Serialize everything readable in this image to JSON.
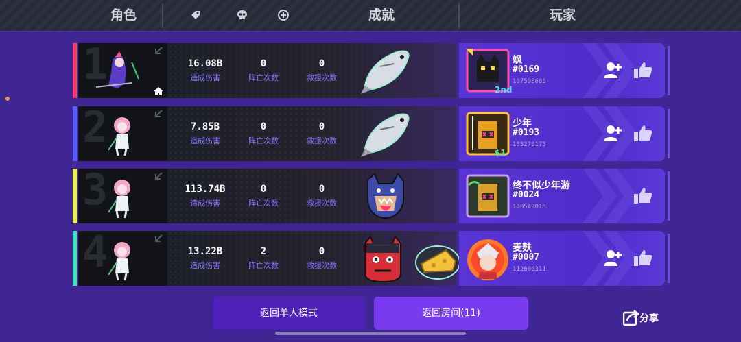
{
  "header": {
    "role_label": "角色",
    "achievement_label": "成就",
    "player_label": "玩家"
  },
  "stat_labels": {
    "damage": "造成伤害",
    "deaths": "阵亡次数",
    "rescues": "救援次数"
  },
  "rows": [
    {
      "rank": "1",
      "stripe_color": "#ff3d6e",
      "damage": "16.08B",
      "deaths": "0",
      "rescues": "0",
      "player": {
        "name": "飒",
        "tag": "#0169",
        "id": "107598686"
      }
    },
    {
      "rank": "2",
      "stripe_color": "#5a5cff",
      "damage": "7.85B",
      "deaths": "0",
      "rescues": "0",
      "player": {
        "name": "少年",
        "tag": "#0193",
        "id": "103270173"
      }
    },
    {
      "rank": "3",
      "stripe_color": "#e8f24a",
      "damage": "113.74B",
      "deaths": "0",
      "rescues": "0",
      "player": {
        "name": "终不似少年游",
        "tag": "#0024",
        "id": "100549018"
      }
    },
    {
      "rank": "4",
      "stripe_color": "#3de0b8",
      "damage": "13.22B",
      "deaths": "2",
      "rescues": "0",
      "player": {
        "name": "麦麸",
        "tag": "#0007",
        "id": "112606311"
      }
    }
  ],
  "avatar_badges": {
    "row1": "2nd",
    "row2": "$1"
  },
  "buttons": {
    "single_mode": "返回单人模式",
    "room": "返回房间(11)",
    "share": "分享"
  }
}
